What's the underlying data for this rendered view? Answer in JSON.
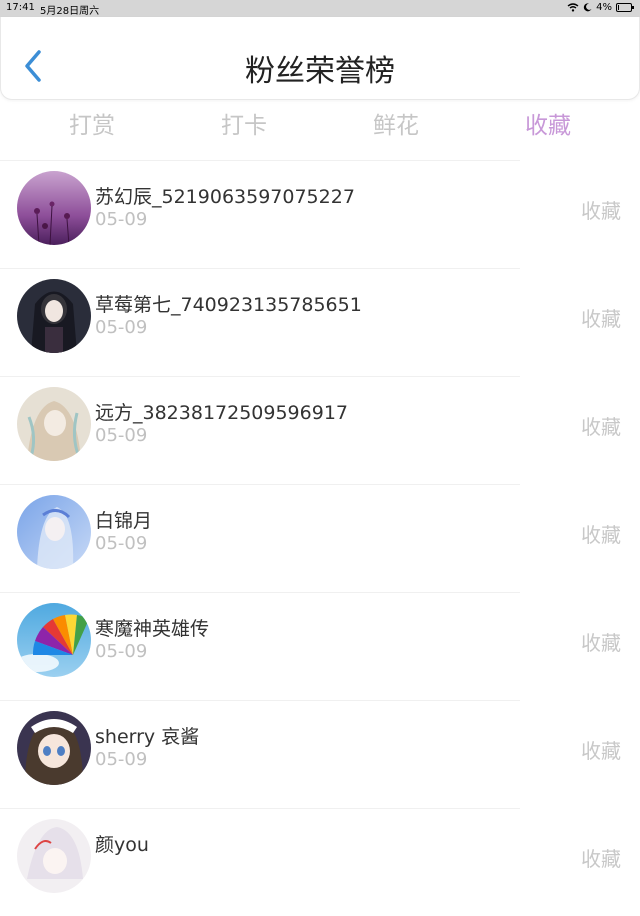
{
  "status_bar": {
    "time": "17:41",
    "date": "5月28日周六",
    "battery": "4%",
    "battery_level": 0.04
  },
  "header": {
    "title": "粉丝荣誉榜"
  },
  "tabs": [
    {
      "label": "打赏",
      "active": false
    },
    {
      "label": "打卡",
      "active": false
    },
    {
      "label": "鲜花",
      "active": false
    },
    {
      "label": "收藏",
      "active": true
    }
  ],
  "colors": {
    "active_tab": "#c898d8",
    "inactive_tab": "#c6c6c6",
    "back_arrow": "#3c8ed6"
  },
  "fans": [
    {
      "name": "苏幻辰_5219063597075227",
      "date": "05-09",
      "action": "收藏",
      "avatar": "avatar-flowers"
    },
    {
      "name": "草莓第七_740923135785651",
      "date": "05-09",
      "action": "收藏",
      "avatar": "avatar-dark-character"
    },
    {
      "name": "远方_38238172509596917",
      "date": "05-09",
      "action": "收藏",
      "avatar": "avatar-pale-character"
    },
    {
      "name": "白锦月",
      "date": "05-09",
      "action": "收藏",
      "avatar": "avatar-blue-character"
    },
    {
      "name": "寒魔神英雄传",
      "date": "05-09",
      "action": "收藏",
      "avatar": "avatar-rainbow-fan"
    },
    {
      "name": "sherry 哀酱",
      "date": "05-09",
      "action": "收藏",
      "avatar": "avatar-maid-character"
    },
    {
      "name": "颜you",
      "date": "",
      "action": "收藏",
      "avatar": "avatar-white-character"
    }
  ]
}
